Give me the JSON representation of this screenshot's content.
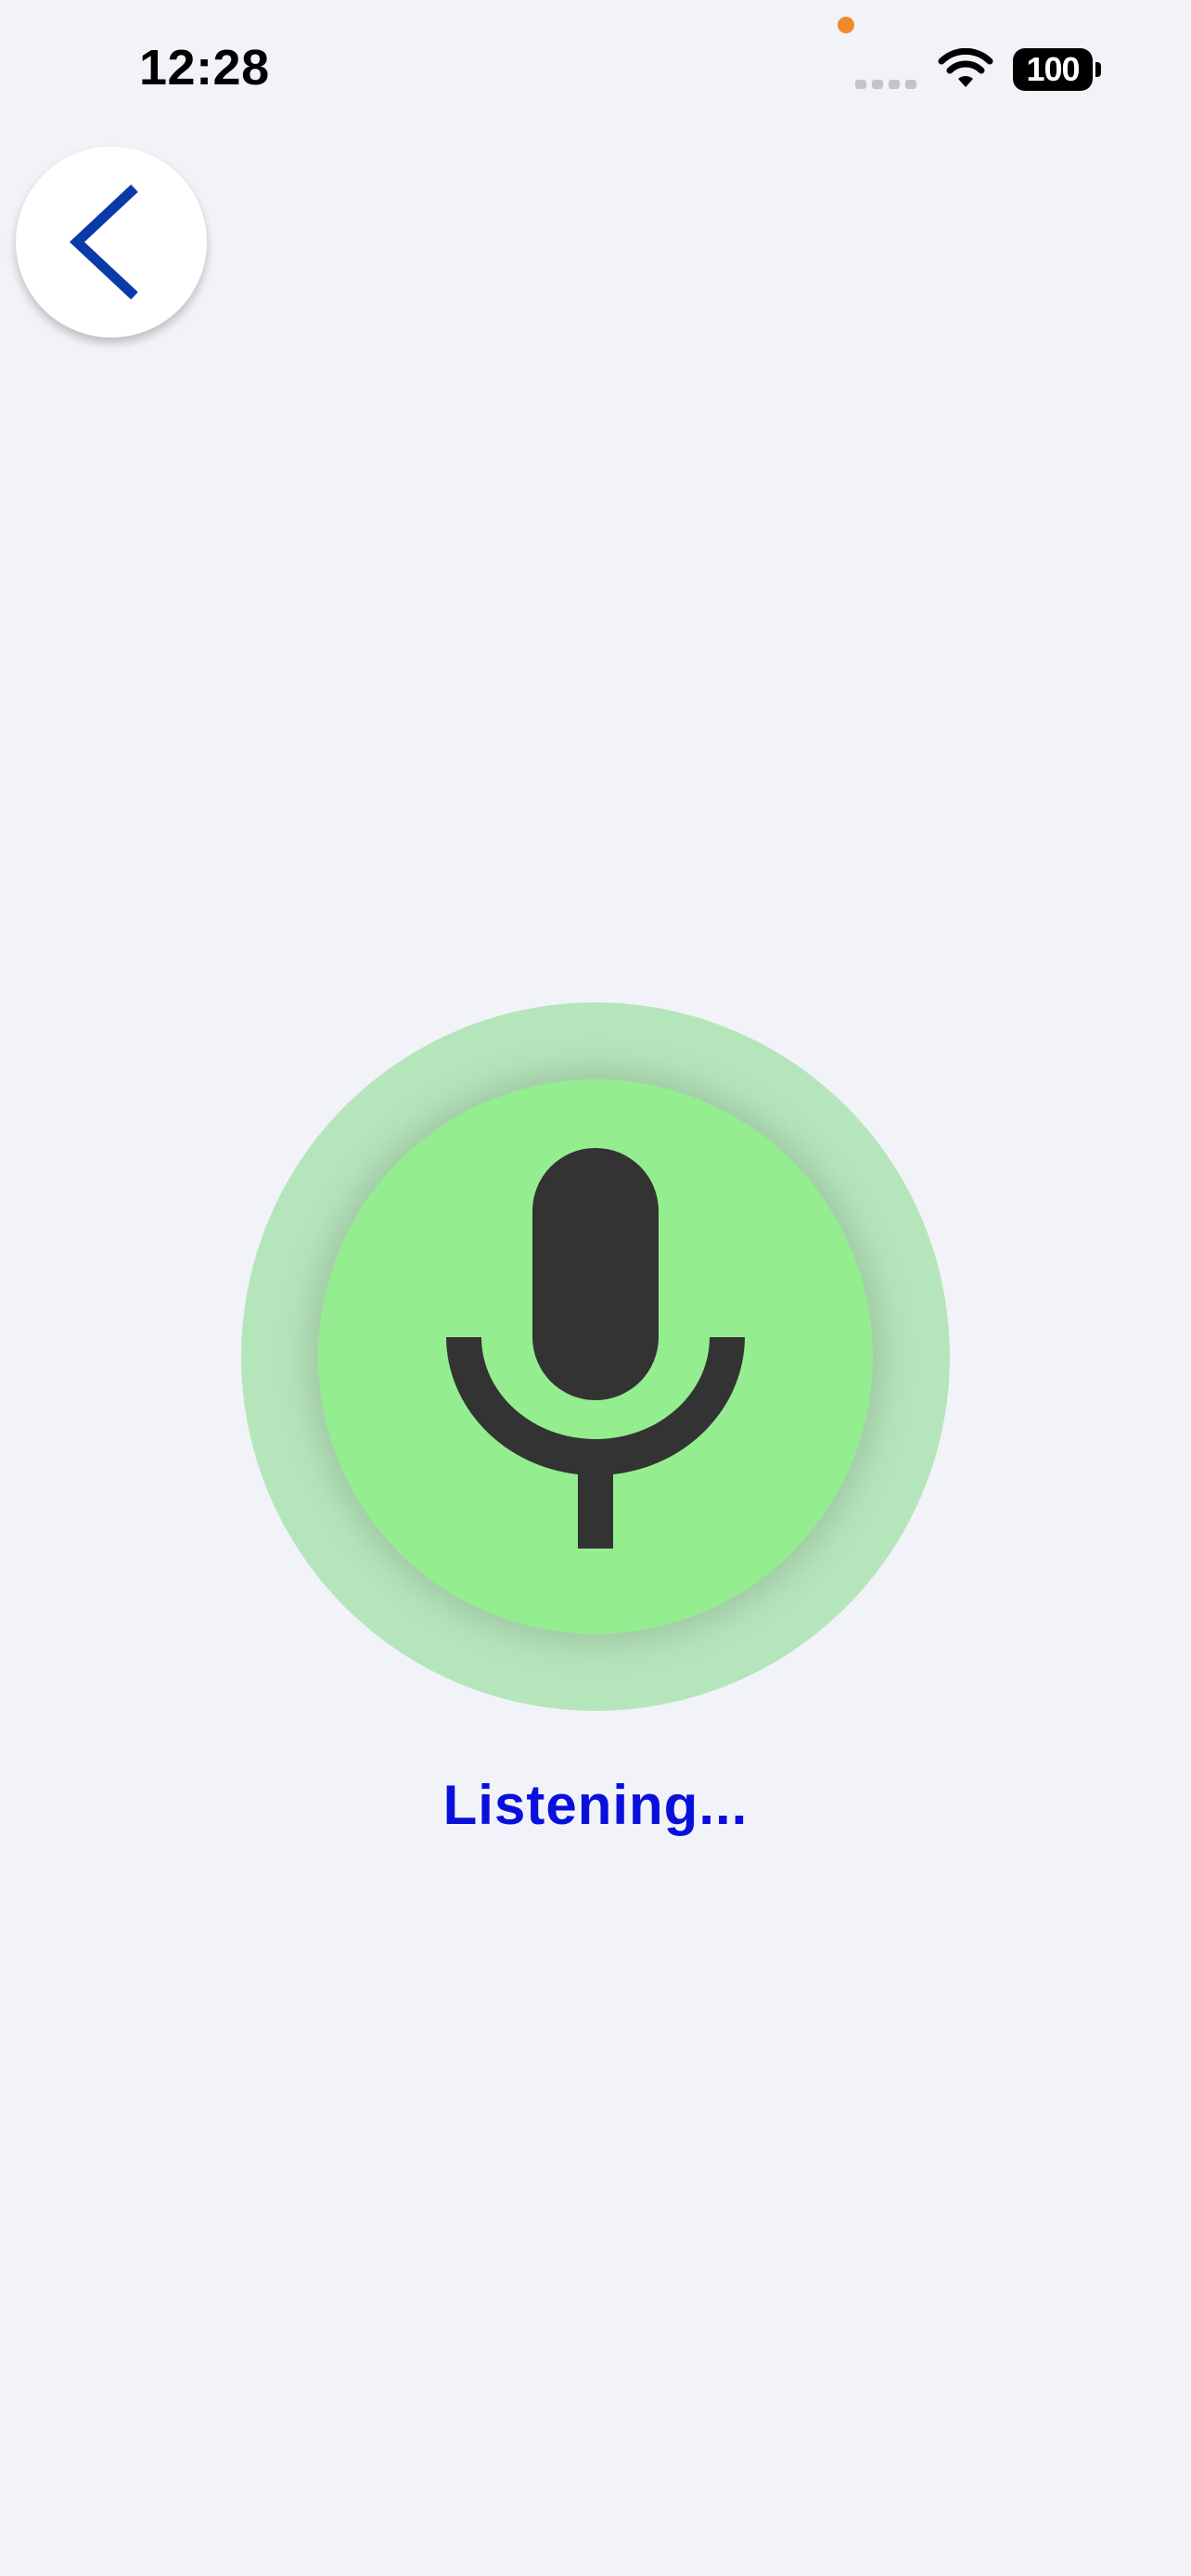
{
  "status_bar": {
    "time": "12:28",
    "battery_level": "100",
    "privacy_dot_color": "#f08a2b",
    "icons": [
      "cellular-signal-icon",
      "wifi-icon",
      "battery-icon"
    ]
  },
  "header": {
    "back_icon": "chevron-left-icon",
    "back_icon_color": "#0a3aa8"
  },
  "voice": {
    "mic_icon": "microphone-icon",
    "outer_ring_color": "#b5e6bb",
    "inner_circle_color": "#94ee8f",
    "icon_color": "#333333",
    "status_text": "Listening...",
    "status_color": "#0a10dc"
  }
}
